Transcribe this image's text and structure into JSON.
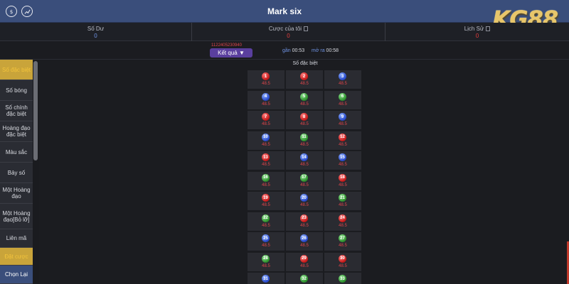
{
  "header": {
    "title": "Mark six",
    "logo_text": "KG88",
    "icons": [
      "money-icon",
      "chart-icon"
    ]
  },
  "stats": {
    "balance_label": "Số Dư",
    "balance_value": "0",
    "my_bets_label": "Cược của tôi",
    "my_bets_value": "0",
    "history_label": "Lịch Sử",
    "history_value": "0"
  },
  "period": {
    "id": "1122405230940",
    "result_button": "Kết quả ▼",
    "close_label": "gần",
    "close_time": "00:53",
    "open_label": "mở ra",
    "open_time": "00:58"
  },
  "sidebar": {
    "items": [
      {
        "label": "Số đặc biệt"
      },
      {
        "label": "Số bóng"
      },
      {
        "label": "Số chính đặc biệt"
      },
      {
        "label": "Hoàng đạo đặc biệt"
      },
      {
        "label": "Màu sắc"
      },
      {
        "label": "Bảy số"
      },
      {
        "label": "Một Hoàng đạo"
      },
      {
        "label": "Một Hoàng đạo[Bỏ lỡ]"
      },
      {
        "label": "Liên mã"
      },
      {
        "label": "Đặt cược"
      },
      {
        "label": "Chọn Lại"
      }
    ]
  },
  "grid": {
    "title": "Số đặc biệt",
    "cells": [
      {
        "n": "1",
        "color": "red",
        "odd": "48.5"
      },
      {
        "n": "2",
        "color": "red",
        "odd": "48.5"
      },
      {
        "n": "3",
        "color": "blue",
        "odd": "48.5"
      },
      {
        "n": "4",
        "color": "blue",
        "odd": "48.5"
      },
      {
        "n": "5",
        "color": "green",
        "odd": "48.5"
      },
      {
        "n": "6",
        "color": "green",
        "odd": "48.5"
      },
      {
        "n": "7",
        "color": "red",
        "odd": "48.5"
      },
      {
        "n": "8",
        "color": "red",
        "odd": "48.5"
      },
      {
        "n": "9",
        "color": "blue",
        "odd": "48.5"
      },
      {
        "n": "10",
        "color": "blue",
        "odd": "48.5"
      },
      {
        "n": "11",
        "color": "green",
        "odd": "48.5"
      },
      {
        "n": "12",
        "color": "red",
        "odd": "48.5"
      },
      {
        "n": "13",
        "color": "red",
        "odd": "48.5"
      },
      {
        "n": "14",
        "color": "blue",
        "odd": "48.5"
      },
      {
        "n": "15",
        "color": "blue",
        "odd": "48.5"
      },
      {
        "n": "16",
        "color": "green",
        "odd": "48.5"
      },
      {
        "n": "17",
        "color": "green",
        "odd": "48.5"
      },
      {
        "n": "18",
        "color": "red",
        "odd": "48.5"
      },
      {
        "n": "19",
        "color": "red",
        "odd": "48.5"
      },
      {
        "n": "20",
        "color": "blue",
        "odd": "48.5"
      },
      {
        "n": "21",
        "color": "green",
        "odd": "48.5"
      },
      {
        "n": "22",
        "color": "green",
        "odd": "48.5"
      },
      {
        "n": "23",
        "color": "red",
        "odd": "48.5"
      },
      {
        "n": "24",
        "color": "red",
        "odd": "48.5"
      },
      {
        "n": "25",
        "color": "blue",
        "odd": "48.5"
      },
      {
        "n": "26",
        "color": "blue",
        "odd": "48.5"
      },
      {
        "n": "27",
        "color": "green",
        "odd": "48.5"
      },
      {
        "n": "28",
        "color": "green",
        "odd": "48.5"
      },
      {
        "n": "29",
        "color": "red",
        "odd": "48.5"
      },
      {
        "n": "30",
        "color": "red",
        "odd": "48.5"
      },
      {
        "n": "31",
        "color": "blue",
        "odd": "48.5"
      },
      {
        "n": "32",
        "color": "green",
        "odd": "48.5"
      },
      {
        "n": "33",
        "color": "green",
        "odd": "48.5"
      }
    ]
  },
  "colors": {
    "header": "#3a4e7b",
    "accent_gold": "#c9a43a",
    "ball_red": "#c41616",
    "ball_blue": "#2446c9",
    "ball_green": "#2a8f2a",
    "odd_text": "#e0454b"
  }
}
